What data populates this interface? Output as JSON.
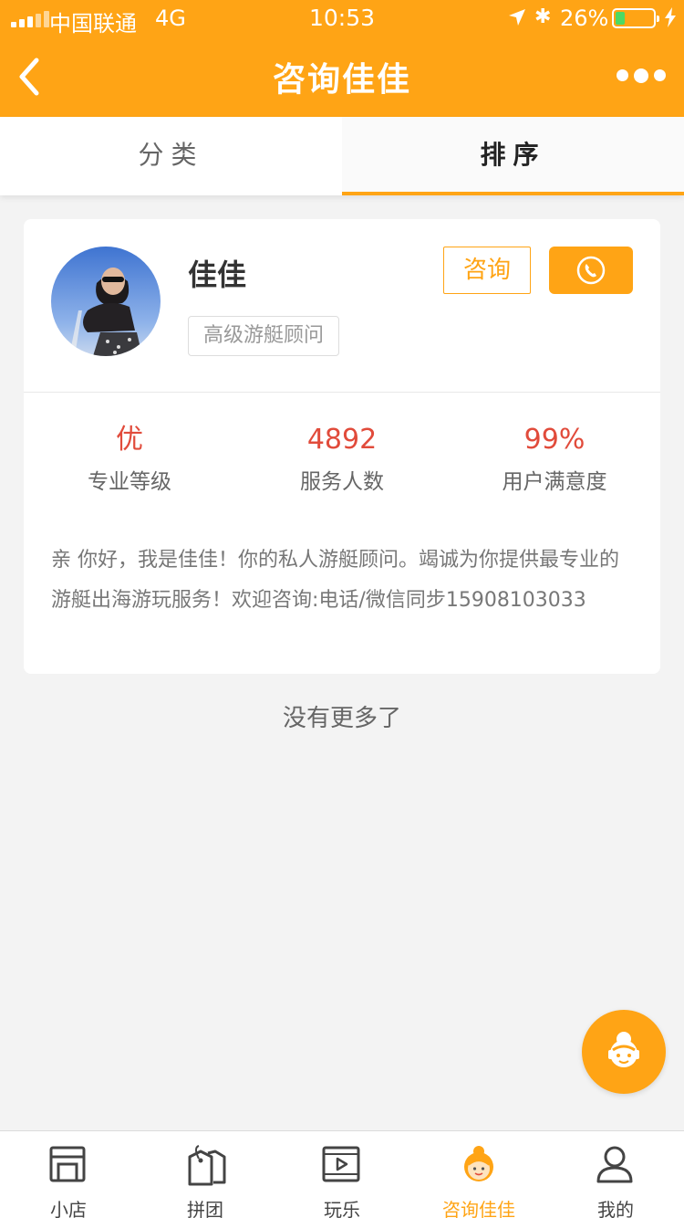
{
  "status_bar": {
    "carrier": "中国联通",
    "network": "4G",
    "time": "10:53",
    "battery_percent": "26%",
    "battery_level": 0.26,
    "battery_color": "#4cd964"
  },
  "nav": {
    "title": "咨询佳佳",
    "back_icon": "chevron-left-icon",
    "more_icon": "more-dots-icon"
  },
  "tabs": [
    {
      "label": "分类",
      "active": false
    },
    {
      "label": "排序",
      "active": true
    }
  ],
  "consultant": {
    "name": "佳佳",
    "title_tag": "高级游艇顾问",
    "consult_button": "咨询",
    "phone_icon": "phone-icon",
    "stats": [
      {
        "value": "优",
        "label": "专业等级"
      },
      {
        "value": "4892",
        "label": "服务人数"
      },
      {
        "value": "99%",
        "label": "用户满意度"
      }
    ],
    "intro": "亲 你好，我是佳佳！你的私人游艇顾问。竭诚为你提供最专业的游艇出海游玩服务！欢迎咨询:电话/微信同步15908103033"
  },
  "list_end_text": "没有更多了",
  "fab_icon": "customer-service-icon",
  "bottom_nav": [
    {
      "label": "小店",
      "icon": "store-icon",
      "active": false
    },
    {
      "label": "拼团",
      "icon": "tags-icon",
      "active": false
    },
    {
      "label": "玩乐",
      "icon": "video-play-icon",
      "active": false
    },
    {
      "label": "咨询佳佳",
      "icon": "consultant-icon",
      "active": true
    },
    {
      "label": "我的",
      "icon": "user-icon",
      "active": false
    }
  ],
  "colors": {
    "accent": "#ffa415",
    "stat_value": "#e14b3b",
    "background": "#f3f3f3"
  }
}
